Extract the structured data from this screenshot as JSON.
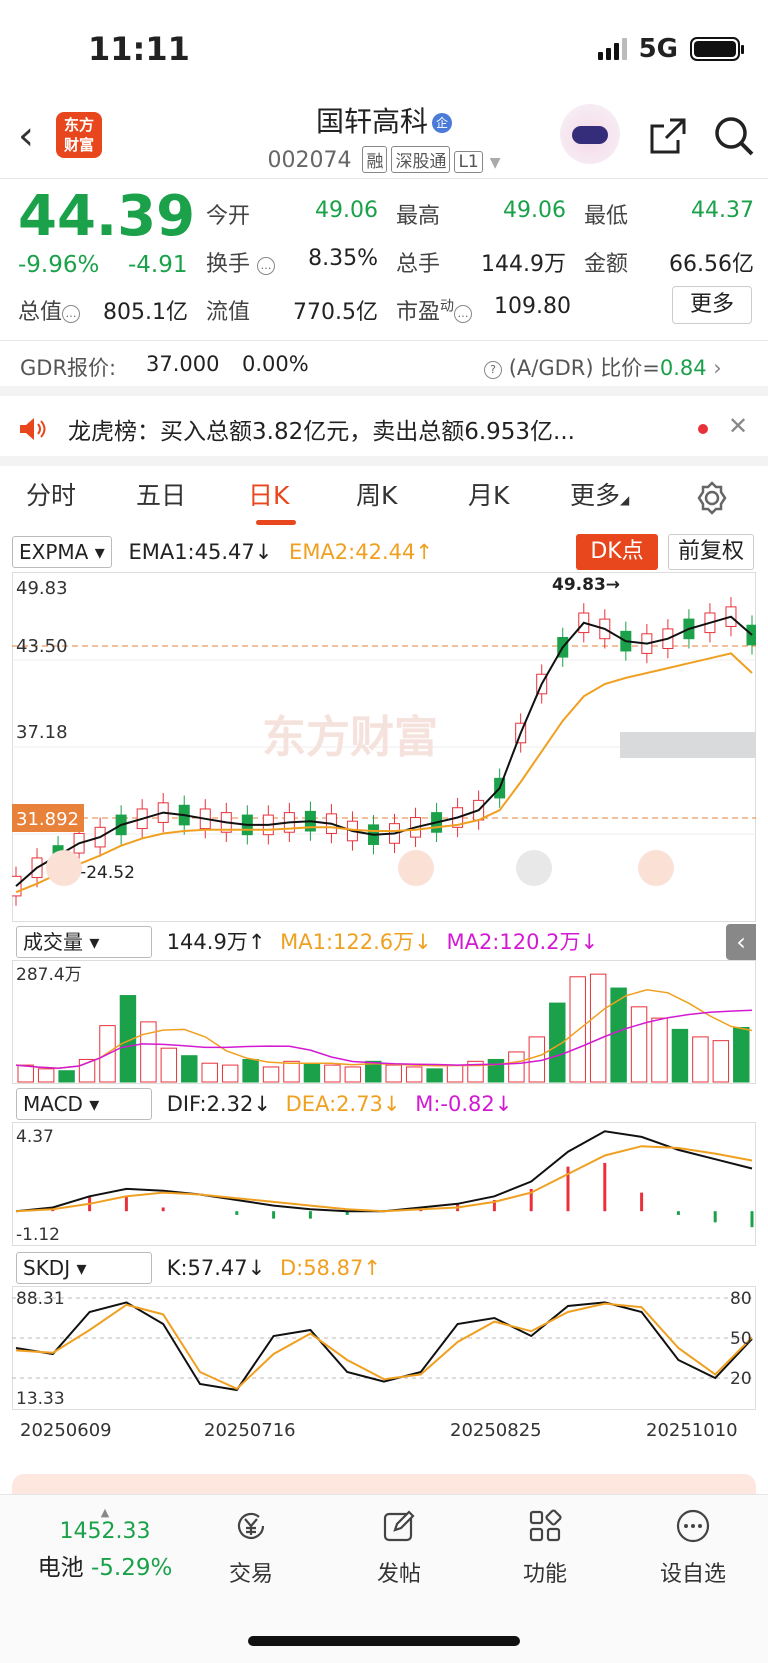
{
  "status": {
    "time": "11:11",
    "network": "5G"
  },
  "header": {
    "title": "国轩高科",
    "badge": "企",
    "code": "002074",
    "tags": [
      "融",
      "深股通",
      "L1"
    ],
    "logo_line1": "东方",
    "logo_line2": "财富"
  },
  "quote": {
    "price": "44.39",
    "change_pct": "-9.96%",
    "change": "-4.91",
    "open_label": "今开",
    "open": "49.06",
    "high_label": "最高",
    "high": "49.06",
    "low_label": "最低",
    "low": "44.37",
    "turnover_label": "换手",
    "turnover": "8.35%",
    "volume_label": "总手",
    "volume": "144.9万",
    "amount_label": "金额",
    "amount": "66.56亿",
    "mktcap_label": "总值",
    "mktcap": "805.1亿",
    "float_label": "流值",
    "float": "770.5亿",
    "pe_label": "市盈",
    "pe_sup": "动",
    "pe": "109.80",
    "more": "更多"
  },
  "gdr": {
    "label": "GDR报价:",
    "price": "37.000",
    "pct": "0.00%",
    "ratio_label": "(A/GDR) 比价=",
    "ratio": "0.84"
  },
  "dragon": {
    "text": "龙虎榜：买入总额3.82亿元，卖出总额6.953亿..."
  },
  "tabs": [
    "分时",
    "五日",
    "日K",
    "周K",
    "月K",
    "更多"
  ],
  "main_chart": {
    "indicator": "EXPMA",
    "ema1": "EMA1:45.47",
    "ema1_arrow": "↓",
    "ema2": "EMA2:42.44",
    "ema2_arrow": "↑",
    "dk_button": "DK点",
    "fq_button": "前复权",
    "top_label": "49.83",
    "mid_label": "43.50",
    "low_label": "37.18",
    "base_label": "31.892",
    "bottom_label": "24.52",
    "high_marker": "49.83→",
    "low_marker": "←24.52",
    "watermark": "东方财富"
  },
  "volume": {
    "indicator": "成交量",
    "vol": "144.9万",
    "vol_arrow": "↑",
    "ma1": "MA1:122.6万",
    "ma1_arrow": "↓",
    "ma2": "MA2:120.2万",
    "ma2_arrow": "↓",
    "max_label": "287.4万"
  },
  "macd": {
    "indicator": "MACD",
    "dif": "DIF:2.32",
    "dif_arrow": "↓",
    "dea": "DEA:2.73",
    "dea_arrow": "↓",
    "m": "M:-0.82",
    "m_arrow": "↓",
    "top": "4.37",
    "bottom": "-1.12"
  },
  "skdj": {
    "indicator": "SKDJ",
    "k": "K:57.47",
    "k_arrow": "↓",
    "d": "D:58.87",
    "d_arrow": "↑",
    "top": "88.31",
    "bottom": "13.33",
    "r80": "80",
    "r50": "50",
    "r20": "20"
  },
  "dates": [
    "20250609",
    "20250716",
    "20250825",
    "20251010"
  ],
  "bottom_nav": {
    "index_value": "1452.33",
    "index_name": "电池",
    "index_pct": "-5.29%",
    "trade": "交易",
    "post": "发帖",
    "function": "功能",
    "watch": "设自选"
  },
  "colors": {
    "up": "#e8313a",
    "down": "#1aa14a",
    "accent": "#e8461c",
    "ema2": "#f0a020",
    "ma2": "#d31ad3"
  },
  "chart_data": [
    {
      "type": "line",
      "title": "EXPMA",
      "series": [
        {
          "name": "EMA1",
          "values": [
            25.0,
            26.5,
            27.5,
            28.5,
            29.0,
            30.0,
            30.5,
            31.0,
            30.8,
            30.5,
            30.2,
            30.0,
            30.0,
            30.2,
            30.3,
            30.1,
            29.5,
            29.2,
            29.3,
            29.8,
            30.2,
            30.6,
            31.2,
            33.0,
            37.5,
            41.5,
            44.5,
            46.5,
            46.0,
            45.0,
            44.8,
            45.2,
            46.0,
            46.5,
            47.0,
            45.5
          ]
        },
        {
          "name": "EMA2",
          "values": [
            24.5,
            25.2,
            26.0,
            26.8,
            27.5,
            28.3,
            28.9,
            29.3,
            29.5,
            29.6,
            29.6,
            29.6,
            29.6,
            29.7,
            29.8,
            29.8,
            29.6,
            29.5,
            29.5,
            29.6,
            29.8,
            30.0,
            30.4,
            31.2,
            33.5,
            36.0,
            38.5,
            40.5,
            41.5,
            42.0,
            42.4,
            42.8,
            43.2,
            43.6,
            44.0,
            42.4
          ]
        }
      ],
      "ylim": [
        24.52,
        49.83
      ]
    },
    {
      "type": "bar",
      "title": "成交量",
      "unit": "万",
      "ylim": [
        0,
        287.4
      ],
      "values": [
        45,
        35,
        30,
        60,
        150,
        230,
        160,
        90,
        70,
        50,
        45,
        60,
        40,
        55,
        50,
        45,
        40,
        55,
        45,
        40,
        35,
        45,
        55,
        60,
        80,
        120,
        210,
        280,
        287,
        250,
        200,
        170,
        140,
        120,
        110,
        145
      ]
    },
    {
      "type": "line",
      "title": "MACD",
      "ylim": [
        -1.12,
        4.37
      ],
      "series": [
        {
          "name": "DIF",
          "values": [
            0.0,
            0.2,
            0.8,
            1.2,
            1.1,
            0.9,
            0.6,
            0.3,
            0.1,
            0.0,
            0.0,
            0.2,
            0.4,
            0.8,
            1.6,
            3.2,
            4.3,
            4.0,
            3.3,
            2.8,
            2.3
          ]
        },
        {
          "name": "DEA",
          "values": [
            0.0,
            0.1,
            0.4,
            0.8,
            1.0,
            0.9,
            0.7,
            0.5,
            0.3,
            0.1,
            0.0,
            0.1,
            0.2,
            0.5,
            1.0,
            2.0,
            3.0,
            3.5,
            3.4,
            3.1,
            2.73
          ]
        }
      ]
    },
    {
      "type": "line",
      "title": "SKDJ",
      "ylim": [
        13.33,
        88.31
      ],
      "series": [
        {
          "name": "K",
          "values": [
            50,
            45,
            80,
            88,
            70,
            20,
            15,
            60,
            65,
            30,
            22,
            30,
            70,
            75,
            60,
            85,
            88,
            80,
            40,
            25,
            57.47
          ]
        },
        {
          "name": "D",
          "values": [
            48,
            46,
            65,
            86,
            78,
            30,
            16,
            45,
            62,
            40,
            24,
            28,
            55,
            72,
            64,
            80,
            87,
            84,
            50,
            28,
            58.87
          ]
        }
      ]
    }
  ]
}
